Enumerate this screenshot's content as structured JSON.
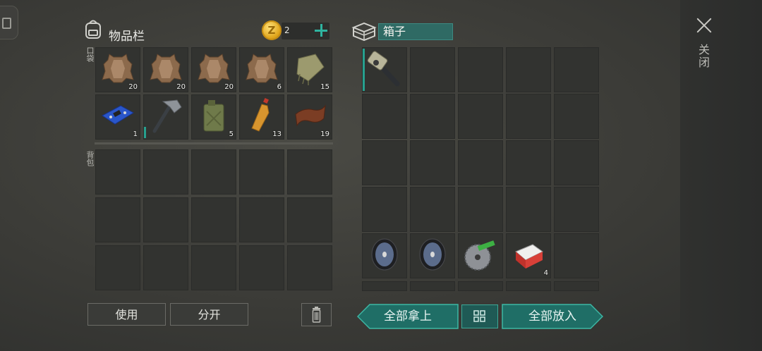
{
  "inventory": {
    "title": "物品栏",
    "coins": "2",
    "pocket_label": "口袋",
    "backpack_label": "背包",
    "pocket_items": [
      {
        "icon": "hide-icon",
        "qty": "20"
      },
      {
        "icon": "hide-icon",
        "qty": "20"
      },
      {
        "icon": "hide-icon",
        "qty": "20"
      },
      {
        "icon": "hide-icon",
        "qty": "6"
      },
      {
        "icon": "cloth-icon",
        "qty": "15"
      },
      {
        "icon": "circuit-board-icon",
        "qty": "1"
      },
      {
        "icon": "hatchet-icon",
        "qty": ""
      },
      {
        "icon": "jerry-can-icon",
        "qty": "5"
      },
      {
        "icon": "bottle-icon",
        "qty": "13"
      },
      {
        "icon": "leather-icon",
        "qty": "19"
      }
    ]
  },
  "chest": {
    "title": "箱子",
    "items": [
      {
        "row": 0,
        "col": 0,
        "icon": "chainsaw-icon",
        "qty": ""
      },
      {
        "row": 4,
        "col": 0,
        "icon": "wheel-icon",
        "qty": ""
      },
      {
        "row": 4,
        "col": 1,
        "icon": "wheel-icon",
        "qty": ""
      },
      {
        "row": 4,
        "col": 2,
        "icon": "saw-blade-icon",
        "qty": ""
      },
      {
        "row": 4,
        "col": 3,
        "icon": "cigarettes-icon",
        "qty": "4"
      }
    ]
  },
  "actions": {
    "use": "使用",
    "split": "分开",
    "take_all": "全部拿上",
    "put_all": "全部放入",
    "close": "关闭"
  },
  "colors": {
    "accent": "#2fb4a0",
    "button_teal": "#1f6e66"
  }
}
